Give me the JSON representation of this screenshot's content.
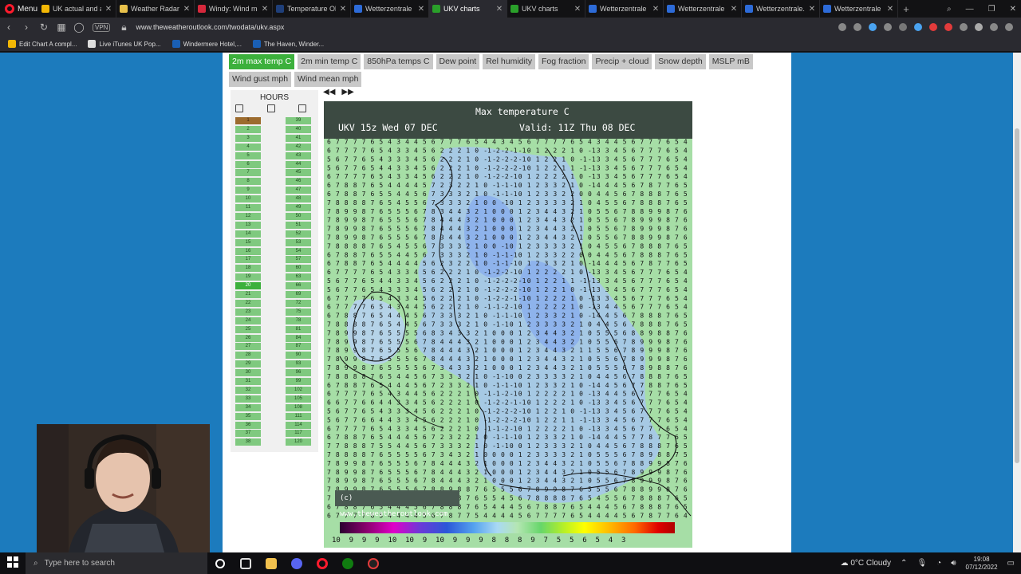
{
  "browser": {
    "menu_label": "Menu",
    "tabs": [
      {
        "title": "UK actual and an",
        "color": "#f2b705",
        "active": false
      },
      {
        "title": "Weather Radar -",
        "color": "#e8c14b",
        "active": false
      },
      {
        "title": "Windy: Wind map",
        "color": "#d6283c",
        "active": false
      },
      {
        "title": "Temperature Obs",
        "color": "#1f3f7a",
        "active": false
      },
      {
        "title": "Wetterzentrale - ",
        "color": "#2d6bd8",
        "active": false
      },
      {
        "title": "UKV charts",
        "color": "#2aa02a",
        "active": true
      },
      {
        "title": "UKV charts",
        "color": "#2aa02a",
        "active": false
      },
      {
        "title": "Wetterzentrale - ",
        "color": "#2d6bd8",
        "active": false
      },
      {
        "title": "Wetterzentrale - ",
        "color": "#2d6bd8",
        "active": false
      },
      {
        "title": "Wetterzentrale.de",
        "color": "#2d6bd8",
        "active": false
      },
      {
        "title": "Wetterzentrale - ",
        "color": "#2d6bd8",
        "active": false
      }
    ],
    "url": "www.theweatheroutlook.com/twodata/ukv.aspx",
    "vpn_label": "VPN",
    "bookmarks": [
      {
        "label": "Edit Chart A compl...",
        "color": "#f2b705"
      },
      {
        "label": "Live iTunes UK Pop...",
        "color": "#dddddd"
      },
      {
        "label": "Windermere Hotel,...",
        "color": "#1a5fb4"
      },
      {
        "label": "The Haven, Winder...",
        "color": "#1a5fb4"
      }
    ]
  },
  "params": {
    "items": [
      {
        "label": "2m max temp C",
        "active": true
      },
      {
        "label": "2m min temp C",
        "active": false
      },
      {
        "label": "850hPa temps C",
        "active": false
      },
      {
        "label": "Dew point",
        "active": false
      },
      {
        "label": "Rel humidity",
        "active": false
      },
      {
        "label": "Fog fraction",
        "active": false
      },
      {
        "label": "Precip + cloud",
        "active": false
      },
      {
        "label": "Snow depth",
        "active": false
      },
      {
        "label": "MSLP mB",
        "active": false
      },
      {
        "label": "Wind gust mph",
        "active": false
      },
      {
        "label": "Wind mean mph",
        "active": false
      }
    ]
  },
  "hours": {
    "title": "HOURS",
    "left_column": [
      "1",
      "2",
      "3",
      "4",
      "5",
      "6",
      "7",
      "8",
      "9",
      "10",
      "11",
      "12",
      "13",
      "14",
      "15",
      "16",
      "17",
      "18",
      "19",
      "20",
      "21",
      "22",
      "23",
      "24",
      "25",
      "26",
      "27",
      "28",
      "29",
      "30",
      "31",
      "32",
      "33",
      "34",
      "35",
      "36",
      "37",
      "38"
    ],
    "right_column": [
      "39",
      "40",
      "41",
      "42",
      "43",
      "44",
      "45",
      "46",
      "47",
      "48",
      "49",
      "50",
      "51",
      "52",
      "53",
      "54",
      "57",
      "60",
      "63",
      "66",
      "69",
      "72",
      "75",
      "78",
      "81",
      "84",
      "87",
      "90",
      "93",
      "96",
      "99",
      "102",
      "105",
      "108",
      "111",
      "114",
      "117",
      "120"
    ],
    "selected_left_index": 19
  },
  "chart": {
    "nav_prev": "◀◀",
    "nav_next": "▶▶",
    "title": "Max temperature  C",
    "run": "UKV 15z Wed 07 DEC",
    "valid": "Valid: 11Z Thu 08 DEC",
    "copyright": "(c) www.theweatheroutlook.com",
    "scale_bottom_row": "10  9  9  9  10  10  9  10  9  9  9  8  8  8  9  7  5  5  6  5  4  3"
  },
  "taskbar": {
    "search_placeholder": "Type here to search",
    "weather": "0°C  Cloudy",
    "time": "19:08",
    "date": "07/12/2022"
  }
}
